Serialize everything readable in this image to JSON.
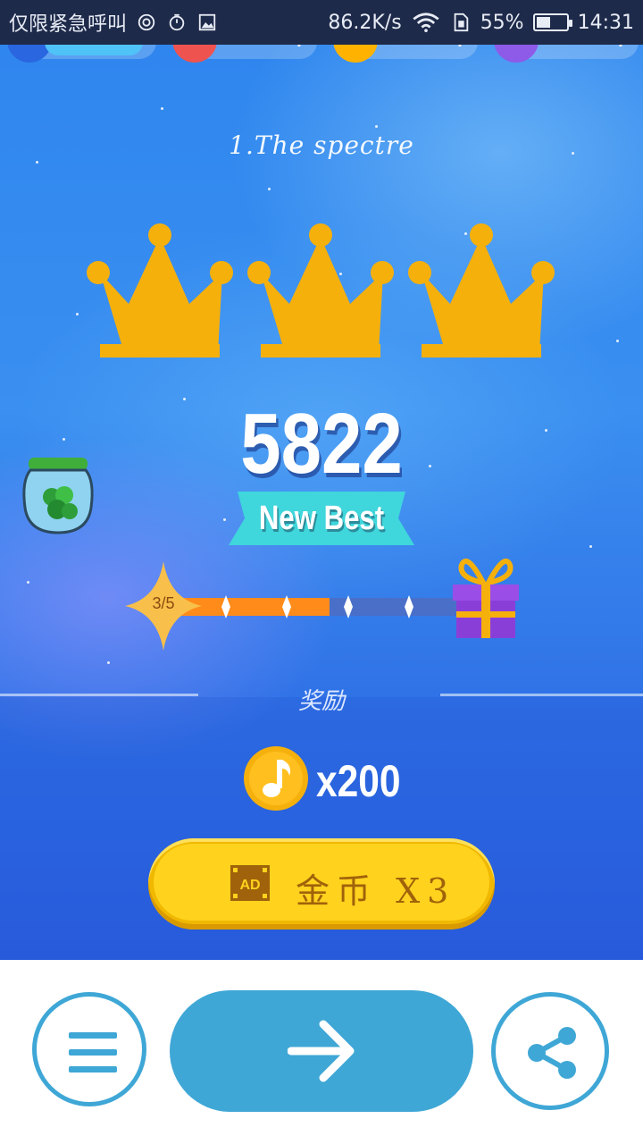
{
  "status_bar": {
    "carrier": "仅限紧急呼叫",
    "net_speed": "86.2K/s",
    "battery_percent": "55%",
    "battery_level": 0.55,
    "time": "14:31"
  },
  "game": {
    "song_title": "1.The spectre",
    "crowns_earned": 3,
    "score": "5822",
    "badge": "New Best",
    "progress": {
      "label": "3/5",
      "current": 3,
      "total": 5,
      "fill_fraction": 0.55
    },
    "reward": {
      "title": "奖励",
      "amount": "x200"
    },
    "ad_button": {
      "icon_text": "AD",
      "label": "金币 X3"
    }
  },
  "colors": {
    "crown": "#f5b00c",
    "accent": "#3fa7d6",
    "ribbon": "#3fd6dc",
    "progress_fill": "#ff8b1a",
    "progress_track": "#4a6fc8",
    "ad_button": "#ffd21e"
  }
}
